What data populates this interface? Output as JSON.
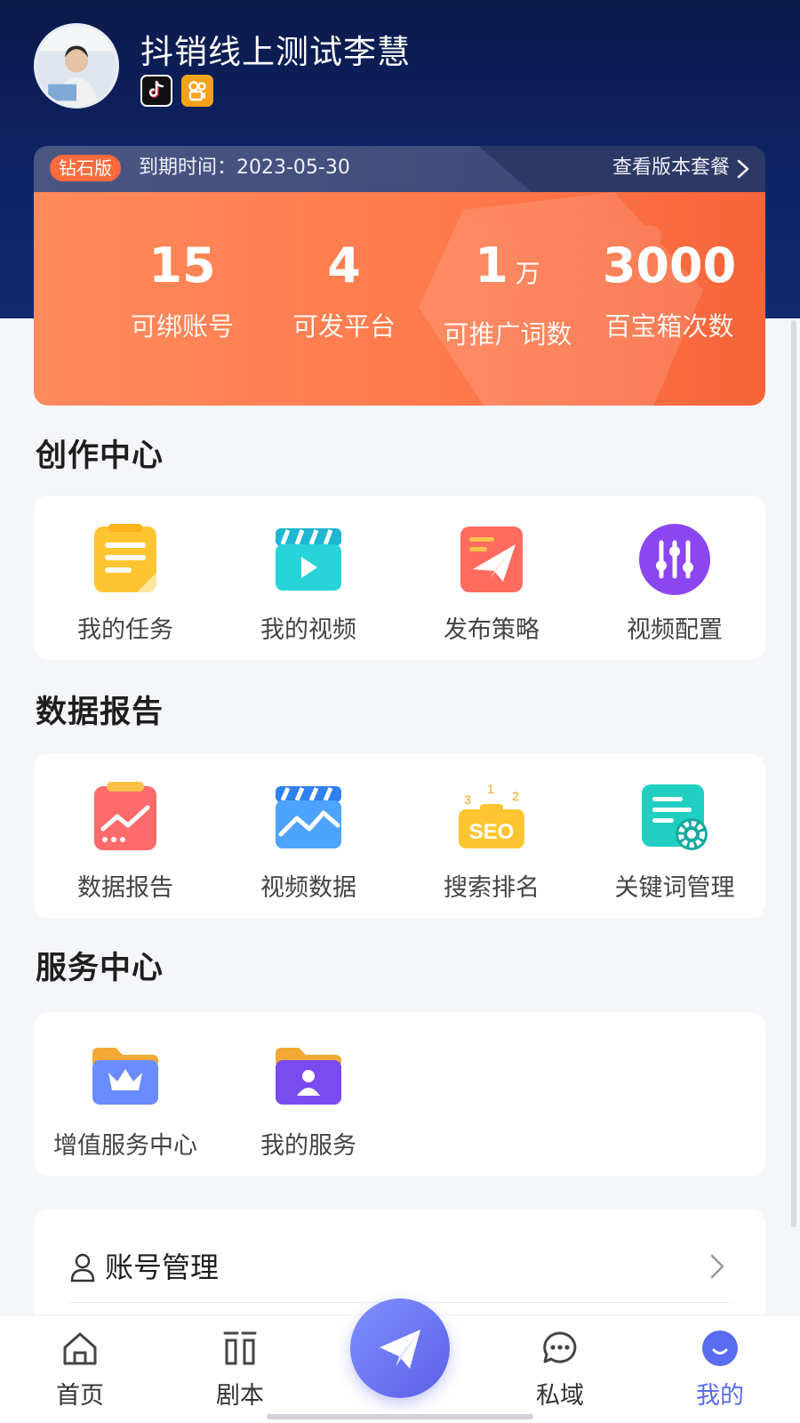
{
  "profile": {
    "username": "抖销线上测试李慧",
    "avatar_icon": "user-photo",
    "platforms": [
      "douyin-icon",
      "kuaishou-icon"
    ]
  },
  "membership": {
    "level": "钻石版",
    "expire": "到期时间：2023-05-30",
    "view_plan": "查看版本套餐",
    "stats": [
      {
        "value": "15",
        "unit": "",
        "label": "可绑账号"
      },
      {
        "value": "4",
        "unit": "",
        "label": "可发平台"
      },
      {
        "value": "1",
        "unit": "万",
        "label": "可推广词数"
      },
      {
        "value": "3000",
        "unit": "",
        "label": "百宝箱次数"
      }
    ]
  },
  "sections": [
    {
      "title": "创作中心",
      "items": [
        {
          "label": "我的任务",
          "icon": "task-note-icon"
        },
        {
          "label": "我的视频",
          "icon": "video-clapper-icon"
        },
        {
          "label": "发布策略",
          "icon": "paper-plane-icon"
        },
        {
          "label": "视频配置",
          "icon": "sliders-icon"
        }
      ]
    },
    {
      "title": "数据报告",
      "items": [
        {
          "label": "数据报告",
          "icon": "report-chart-icon"
        },
        {
          "label": "视频数据",
          "icon": "video-data-icon"
        },
        {
          "label": "搜索排名",
          "icon": "seo-icon"
        },
        {
          "label": "关键词管理",
          "icon": "keyword-gear-icon"
        }
      ]
    },
    {
      "title": "服务中心",
      "items": [
        {
          "label": "增值服务中心",
          "icon": "crown-folder-icon"
        },
        {
          "label": "我的服务",
          "icon": "person-folder-icon"
        }
      ]
    }
  ],
  "account": {
    "label": "账号管理"
  },
  "seo_text": "SEO",
  "seo_ranks": [
    "1",
    "2",
    "3"
  ],
  "tabbar": [
    {
      "label": "首页",
      "icon": "home-icon"
    },
    {
      "label": "剧本",
      "icon": "script-icon"
    },
    {
      "label": "",
      "icon": "send-plane-icon"
    },
    {
      "label": "私域",
      "icon": "chat-bubble-icon"
    },
    {
      "label": "我的",
      "icon": "profile-icon"
    }
  ],
  "colors": {
    "header_bg": "#0f2467",
    "accent_orange": "#ff7a4c",
    "active_tab": "#5a6cf0"
  }
}
